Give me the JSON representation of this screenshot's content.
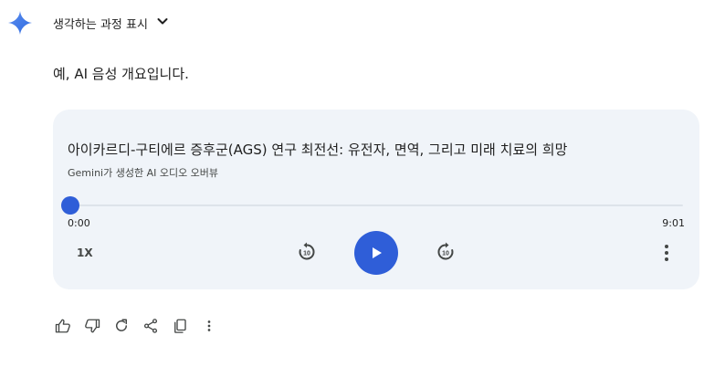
{
  "header": {
    "thinking_label": "생각하는 과정 표시",
    "brand_color": "#4285f4"
  },
  "response": {
    "intro_text": "예, AI 음성 개요입니다."
  },
  "audio_overview": {
    "title": "아이카르디-구티에르 증후군(AGS) 연구 최전선: 유전자, 면역, 그리고 미래 치료의 희망",
    "subtitle": "Gemini가 생성한 AI 오디오 오버뷰",
    "current_time": "0:00",
    "duration": "9:01",
    "progress": 0,
    "speed_label": "1X",
    "rewind_seconds": "10",
    "forward_seconds": "10",
    "accent_color": "#2f5ed8"
  },
  "action_bar": {
    "icons": [
      "thumbs-up-icon",
      "thumbs-down-icon",
      "regenerate-icon",
      "share-icon",
      "copy-icon",
      "more-vert-icon"
    ]
  }
}
